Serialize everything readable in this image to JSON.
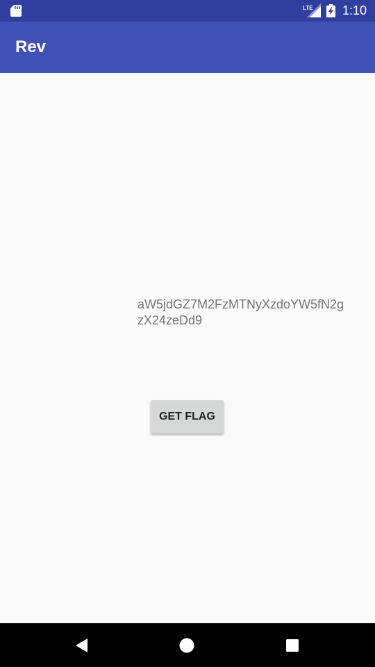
{
  "status_bar": {
    "time": "1:10",
    "network_label": "LTE",
    "icons": [
      "sd-card-icon",
      "lte-signal-icon",
      "battery-charging-icon"
    ]
  },
  "app_bar": {
    "title": "Rev"
  },
  "main": {
    "encoded_text": "aW5jdGZ7M2FzMTNyXzdoYW5fN2gzX24zeDd9",
    "button_label": "GET FLAG"
  },
  "nav_bar": {
    "icons": [
      "back-icon",
      "home-icon",
      "recents-icon"
    ]
  },
  "colors": {
    "status_bar": "#303f9f",
    "app_bar": "#3f51b5",
    "background": "#fafafa",
    "button": "#d6d7d7",
    "text_secondary": "#757575"
  }
}
